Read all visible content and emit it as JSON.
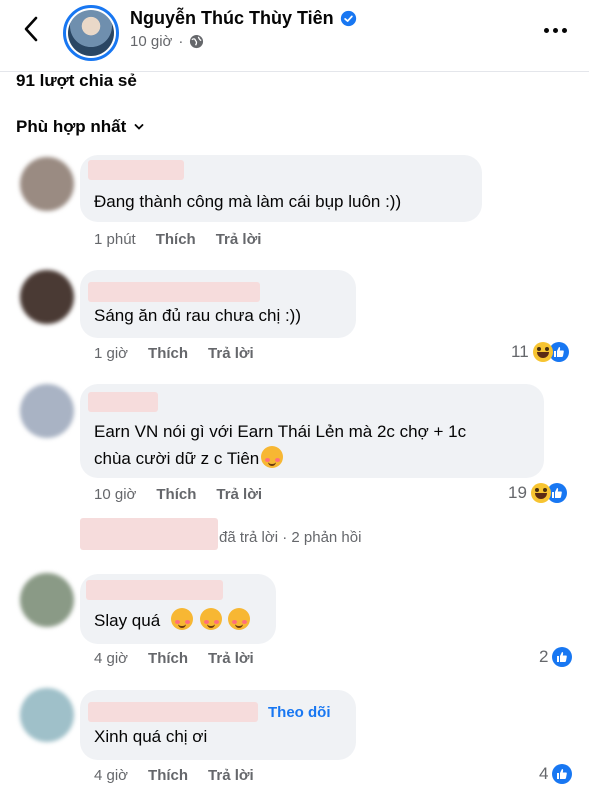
{
  "post": {
    "author": "Nguyễn Thúc Thùy Tiên",
    "time": "10 giờ",
    "share_count": "91 lượt chia sẻ",
    "sort_label": "Phù hợp nhất"
  },
  "labels": {
    "like": "Thích",
    "reply": "Trả lời",
    "follow": "Theo dõi"
  },
  "comments": [
    {
      "text": "Đang thành công mà làm cái bụp luôn :))",
      "time": "1 phút",
      "reaction_count": ""
    },
    {
      "text": "Sáng ăn đủ rau chưa chị :))",
      "time": "1 giờ",
      "reaction_count": "11"
    },
    {
      "text_line1": "Earn VN nói gì với Earn Thái Lẻn mà 2c chợ + 1c",
      "text_line2": "chùa cười dữ z c Tiên",
      "time": "10 giờ",
      "reaction_count": "19"
    },
    {
      "text": "Slay quá",
      "time": "4 giờ",
      "reaction_count": "2"
    },
    {
      "text": "Xinh quá chị ơi",
      "time": "4 giờ",
      "reaction_count": "4"
    }
  ],
  "reply_summary": {
    "replied": "đã trả lời",
    "sep": "·",
    "count": "2 phản hồi"
  },
  "colors": {
    "accent": "#1877f2",
    "bubble": "#f0f2f5",
    "muted": "#65676b"
  }
}
